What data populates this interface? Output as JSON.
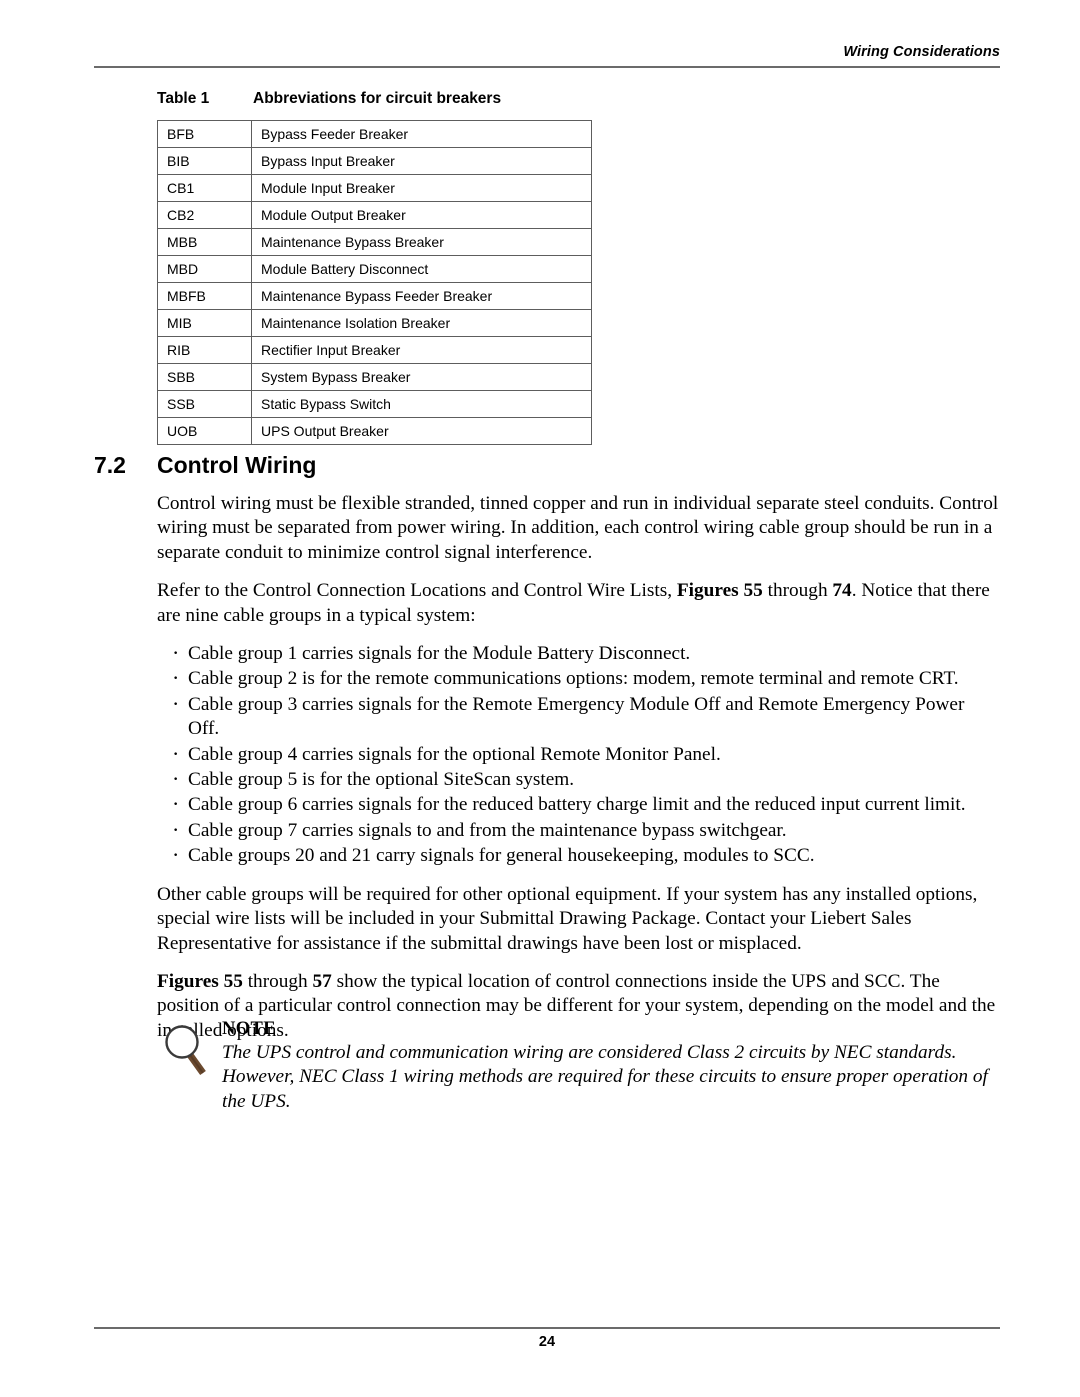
{
  "header": {
    "running_title": "Wiring Considerations",
    "rule_color": "#6b6b6b"
  },
  "table": {
    "caption_label": "Table 1",
    "caption_title": "Abbreviations for circuit breakers",
    "border_color": "#5d5d5d",
    "rows": [
      {
        "abbr": "BFB",
        "description": "Bypass Feeder Breaker"
      },
      {
        "abbr": "BIB",
        "description": "Bypass Input Breaker"
      },
      {
        "abbr": "CB1",
        "description": "Module Input Breaker"
      },
      {
        "abbr": "CB2",
        "description": "Module Output Breaker"
      },
      {
        "abbr": "MBB",
        "description": "Maintenance Bypass Breaker"
      },
      {
        "abbr": "MBD",
        "description": "Module Battery Disconnect"
      },
      {
        "abbr": "MBFB",
        "description": "Maintenance Bypass Feeder Breaker"
      },
      {
        "abbr": "MIB",
        "description": "Maintenance Isolation Breaker"
      },
      {
        "abbr": "RIB",
        "description": "Rectifier Input Breaker"
      },
      {
        "abbr": "SBB",
        "description": "System Bypass Breaker"
      },
      {
        "abbr": "SSB",
        "description": "Static Bypass Switch"
      },
      {
        "abbr": "UOB",
        "description": "UPS Output Breaker"
      }
    ]
  },
  "section": {
    "number": "7.2",
    "title": "Control Wiring"
  },
  "body": {
    "paragraph_1": "Control wiring must be flexible stranded, tinned copper and run in individual separate steel conduits. Control wiring must be separated from power wiring. In addition, each control wiring cable group should be run in a separate conduit to minimize control signal interference.",
    "paragraph_2_part1": "Refer to the Control Connection Locations and Control Wire Lists, ",
    "paragraph_2_bold1": "Figures 55",
    "paragraph_2_part2": " through ",
    "paragraph_2_bold2": "74",
    "paragraph_2_part3": ". Notice that there are nine cable groups in a typical system:",
    "bullets": [
      "Cable group 1 carries signals for the Module Battery Disconnect.",
      "Cable group 2 is for the remote communications options: modem, remote terminal and remote CRT.",
      "Cable group 3 carries signals for the Remote Emergency Module Off and Remote Emergency Power Off.",
      "Cable group 4 carries signals for the optional Remote Monitor Panel.",
      "Cable group 5 is for the optional SiteScan system.",
      "Cable group 6 carries signals for the reduced battery charge limit and the reduced input current limit.",
      "Cable group 7 carries signals to and from the maintenance bypass switchgear.",
      "Cable groups 20 and 21 carry signals for general housekeeping, modules to SCC."
    ],
    "paragraph_3": "Other cable groups will be required for other optional equipment. If your system has any installed options, special wire lists will be included in your Submittal Drawing Package. Contact your Liebert Sales Representative for assistance if the submittal drawings have been lost or misplaced.",
    "paragraph_4_bold1": "Figures 55",
    "paragraph_4_part1": " through ",
    "paragraph_4_bold2": "57",
    "paragraph_4_part2": " show the typical location of control connections inside the UPS and SCC. The position of a particular control connection may be different for your system, depending on the model and the installed options."
  },
  "note": {
    "title": "NOTE",
    "text": "The UPS control and communication wiring are considered Class 2 circuits by NEC standards. However, NEC Class 1 wiring methods are required for these circuits to ensure proper operation of the UPS.",
    "icon": "magnifying-glass-icon",
    "icon_lens_color": "#3a3a3a",
    "icon_handle_color": "#6b4a2f"
  },
  "footer": {
    "page_number": "24",
    "rule_color": "#6b6b6b"
  }
}
